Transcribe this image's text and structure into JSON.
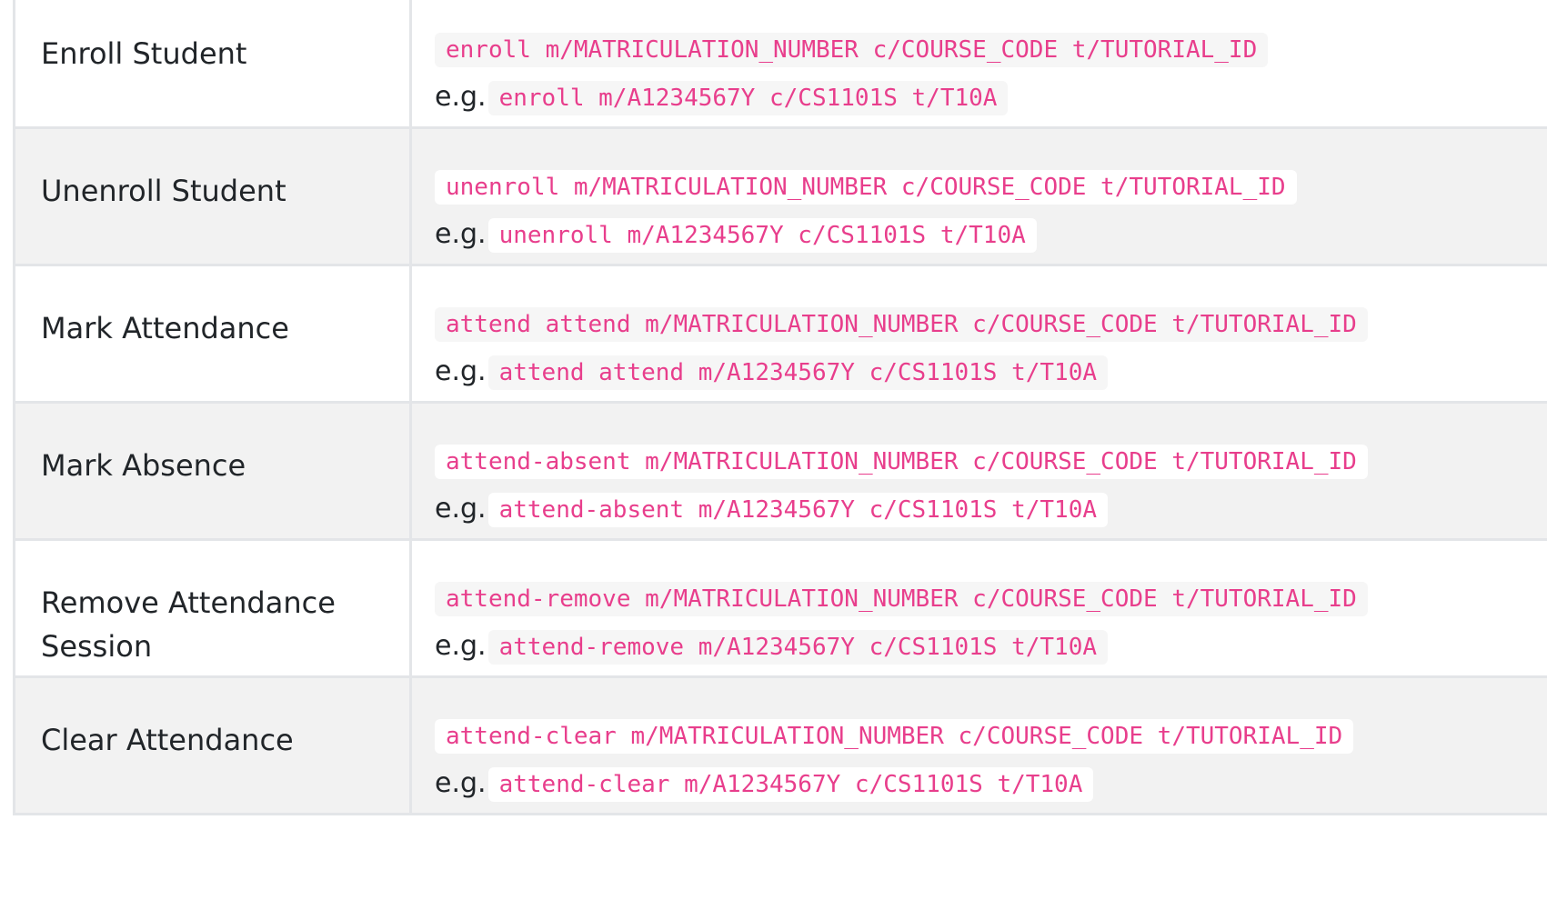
{
  "commands": [
    {
      "action": "Enroll Student",
      "format": "enroll m/MATRICULATION_NUMBER c/COURSE_CODE t/TUTORIAL_ID",
      "example_prefix": "e.g.",
      "example": "enroll m/A1234567Y c/CS1101S t/T10A"
    },
    {
      "action": "Unenroll Student",
      "format": "unenroll m/MATRICULATION_NUMBER c/COURSE_CODE t/TUTORIAL_ID",
      "example_prefix": "e.g.",
      "example": "unenroll m/A1234567Y c/CS1101S t/T10A"
    },
    {
      "action": "Mark Attendance",
      "format": "attend attend m/MATRICULATION_NUMBER c/COURSE_CODE t/TUTORIAL_ID",
      "example_prefix": "e.g.",
      "example": "attend attend m/A1234567Y c/CS1101S t/T10A"
    },
    {
      "action": "Mark Absence",
      "format": "attend-absent m/MATRICULATION_NUMBER c/COURSE_CODE t/TUTORIAL_ID",
      "example_prefix": "e.g.",
      "example": "attend-absent m/A1234567Y c/CS1101S t/T10A"
    },
    {
      "action": "Remove Attendance Session",
      "format": "attend-remove m/MATRICULATION_NUMBER c/COURSE_CODE t/TUTORIAL_ID",
      "example_prefix": "e.g.",
      "example": "attend-remove m/A1234567Y c/CS1101S t/T10A"
    },
    {
      "action": "Clear Attendance",
      "format": "attend-clear m/MATRICULATION_NUMBER c/COURSE_CODE t/TUTORIAL_ID",
      "example_prefix": "e.g.",
      "example": "attend-clear m/A1234567Y c/CS1101S t/T10A"
    }
  ],
  "colors": {
    "code_text": "#e83e8c",
    "text": "#212529",
    "border": "#e3e5e8",
    "row_alt": "#f2f2f2"
  }
}
